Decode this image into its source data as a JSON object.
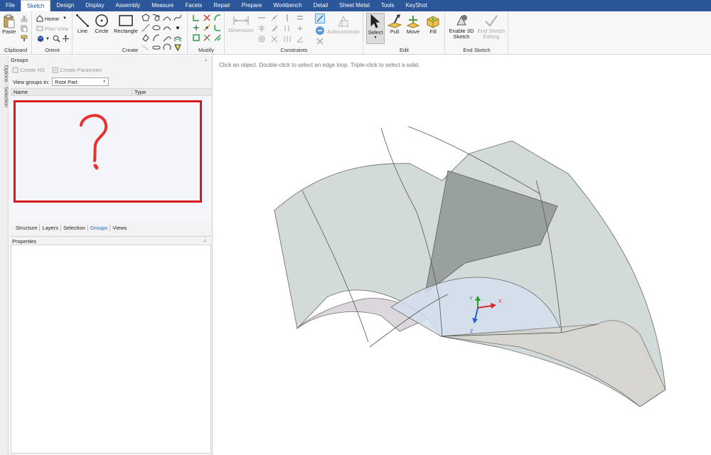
{
  "menu": {
    "items": [
      "File",
      "Sketch",
      "Design",
      "Display",
      "Assembly",
      "Measure",
      "Facets",
      "Repair",
      "Prepare",
      "Workbench",
      "Detail",
      "Sheet Metal",
      "Tools",
      "KeyShot"
    ],
    "active": "Sketch"
  },
  "ribbon": {
    "clipboard": {
      "paste": "Paste",
      "label": "Clipboard"
    },
    "orient": {
      "home": "Home",
      "plan_view": "Plan View",
      "label": "Orient"
    },
    "create": {
      "line": "Line",
      "circle": "Circle",
      "rectangle": "Rectangle",
      "label": "Create"
    },
    "modify": {
      "label": "Modify"
    },
    "constraints": {
      "dimension": "Dimension",
      "autoconstrain": "Autoconstrain",
      "label": "Constraints"
    },
    "edit": {
      "select": "Select",
      "pull": "Pull",
      "move": "Move",
      "fill": "Fill",
      "label": "Edit"
    },
    "end_sketch": {
      "enable_3d": "Enable 3D Sketch",
      "end_editing": "End Sketch Editing",
      "label": "End Sketch"
    }
  },
  "sidebar": {
    "strip_text": "Options - Selection",
    "groups_title": "Groups",
    "create_ns": "Create NS",
    "create_parameter": "Create Parameter",
    "view_groups_label": "View groups in:",
    "view_groups_value": "Root Part",
    "col_name": "Name",
    "col_type": "Type",
    "tabs": [
      "Structure",
      "Layers",
      "Selection",
      "Groups",
      "Views"
    ],
    "active_tab": "Groups",
    "properties_title": "Properties"
  },
  "viewport": {
    "hint": "Click an object. Double-click to select an edge loop. Triple-click to select a solid.",
    "axes": {
      "x": "X",
      "y": "Y",
      "z": "Z"
    }
  },
  "colors": {
    "menubar": "#2b579a",
    "highlight_box": "#d6181f",
    "annotation": "#e8322e"
  }
}
